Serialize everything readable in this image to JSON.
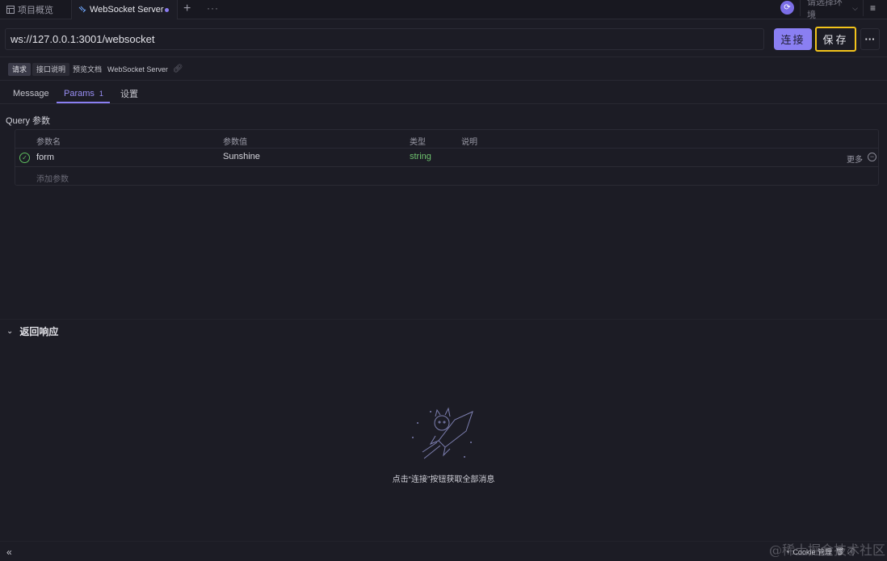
{
  "tabs": {
    "overview_label": "项目概览",
    "active_label": "WebSocket Server",
    "add_icon": "plus-icon",
    "more_icon": "ellipsis-icon"
  },
  "env": {
    "placeholder": "请选择环境"
  },
  "request": {
    "url": "ws://127.0.0.1:3001/websocket",
    "connect_label": "连接",
    "save_label": "保存"
  },
  "breadcrumb": {
    "chips": [
      "请求",
      "接口说明",
      "预览文档"
    ],
    "name": "WebSocket Server"
  },
  "subtabs": [
    {
      "label": "Message"
    },
    {
      "label": "Params",
      "count": "1"
    },
    {
      "label": "设置"
    }
  ],
  "query": {
    "title": "Query 参数",
    "headers": [
      "参数名",
      "参数值",
      "类型",
      "说明"
    ],
    "rows": [
      {
        "name": "form",
        "value": "Sunshine",
        "type": "string",
        "desc": "",
        "more": "更多"
      }
    ],
    "add_placeholder": "添加参数"
  },
  "response": {
    "title": "返回响应",
    "empty_text": "点击“连接”按钮获取全部消息"
  },
  "footer": {
    "cookie_label": "Cookie 管理",
    "watermark": "@稀土掘金技术社区"
  },
  "colors": {
    "accent": "#8a7ff2",
    "save_highlight": "#f2c31b",
    "type_green": "#6ec26e",
    "background": "#1c1c25"
  }
}
